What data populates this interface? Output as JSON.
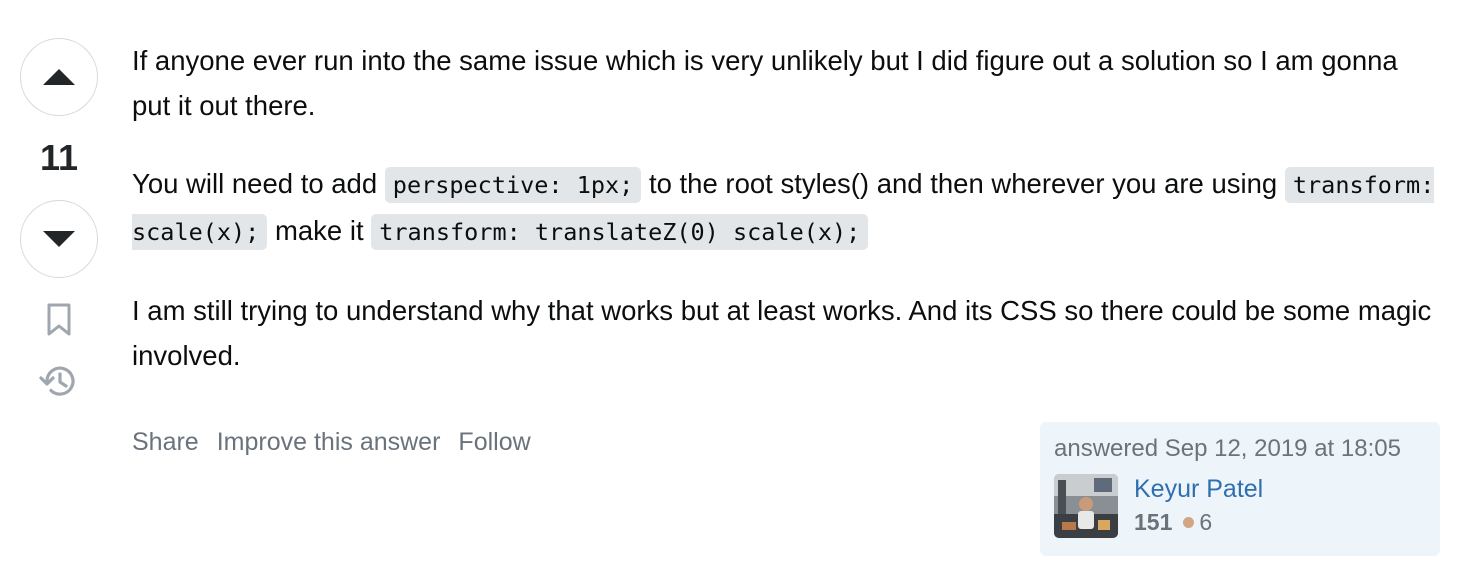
{
  "vote": {
    "count": "11"
  },
  "post": {
    "paragraph1": "If anyone ever run into the same issue which is very unlikely but I did figure out a solution so I am gonna put it out there.",
    "paragraph2": {
      "text_before_code1": "You will need to add ",
      "code1": "perspective: 1px;",
      "text_after_code1": " to the root styles() and then wherever you are using ",
      "code2": "transform: scale(x);",
      "text_after_code2": " make it ",
      "code3": "transform: translateZ(0) scale(x);"
    },
    "paragraph3": "I am still trying to understand why that works but at least works. And its CSS so there could be some magic involved."
  },
  "menu": {
    "share": "Share",
    "improve": "Improve this answer",
    "follow": "Follow"
  },
  "user_card": {
    "answered_time": "answered Sep 12, 2019 at 18:05",
    "user_name": "Keyur Patel",
    "reputation": "151",
    "bronze_badges": "6"
  },
  "colors": {
    "link": "#2f6faf",
    "muted": "#6a737c",
    "card_bg": "#edf4fa",
    "code_bg": "#e3e6e8",
    "bronze": "#d1a684"
  }
}
